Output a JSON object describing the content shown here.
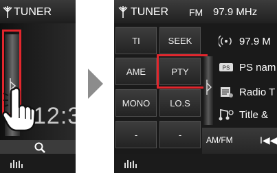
{
  "left_screen": {
    "title": "TUNER",
    "clock": "12:3",
    "icons": [
      "antenna-icon",
      "search-icon",
      "equalizer-icon",
      "drag-handle-icon"
    ]
  },
  "right_screen": {
    "title": "TUNER",
    "band": "FM",
    "frequency": "97.9 MHz",
    "buttons": [
      {
        "label": "TI"
      },
      {
        "label": "SEEK"
      },
      {
        "label": "AME"
      },
      {
        "label": "PTY"
      },
      {
        "label": "MONO"
      },
      {
        "label": "LO.S"
      },
      {
        "label": "-"
      },
      {
        "label": "-"
      }
    ],
    "info": [
      {
        "text": "97.9 M",
        "icon": "broadcast-icon"
      },
      {
        "text": "PS nam",
        "icon": "ps-icon"
      },
      {
        "text": "Radio T",
        "icon": "radio-text-icon"
      },
      {
        "text": "Title &",
        "icon": "title-icon"
      }
    ],
    "control_bar": {
      "mode": "AM/FM",
      "prev": "I◀◀"
    },
    "icons": [
      "antenna-icon",
      "equalizer-icon",
      "drag-handle-icon"
    ]
  },
  "colors": {
    "highlight": "#e3262d",
    "background": "#1a1a1a"
  }
}
